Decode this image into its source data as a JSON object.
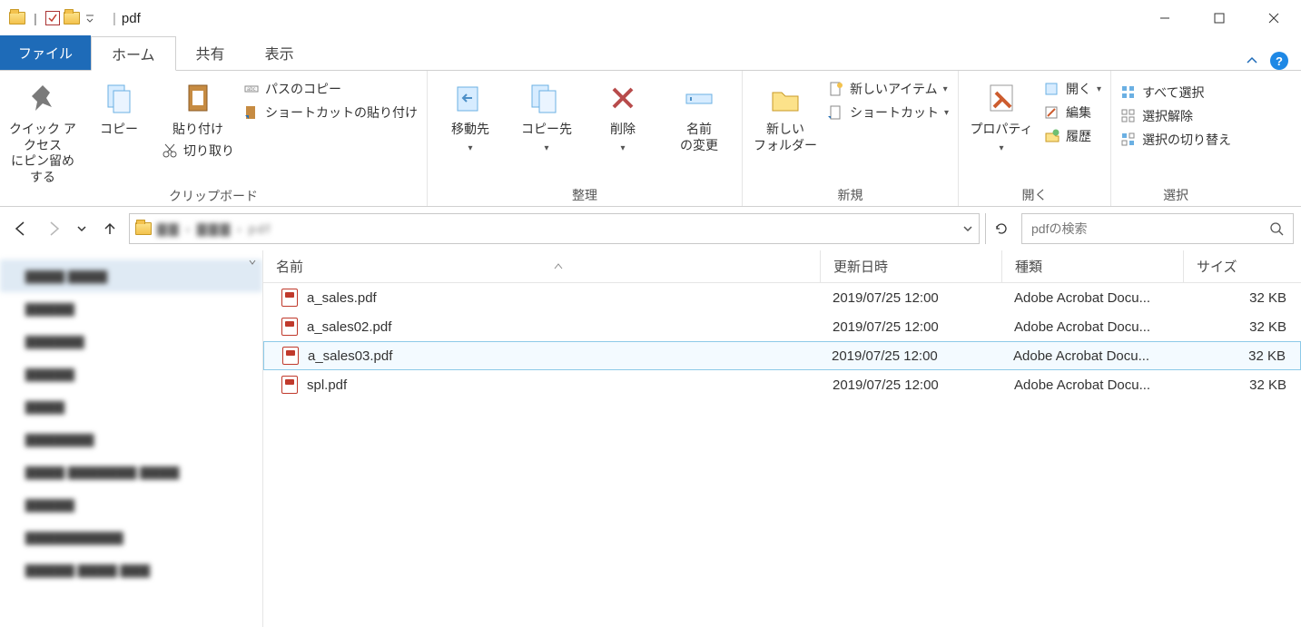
{
  "window": {
    "title": "pdf"
  },
  "tabs": {
    "file": "ファイル",
    "home": "ホーム",
    "share": "共有",
    "view": "表示"
  },
  "ribbon": {
    "clipboard": {
      "pin_label": "クイック アクセス\nにピン留めする",
      "copy_label": "コピー",
      "paste_label": "貼り付け",
      "cut_label": "切り取り",
      "copy_path_label": "パスのコピー",
      "paste_shortcut_label": "ショートカットの貼り付け",
      "group_label": "クリップボード"
    },
    "organize": {
      "move_label": "移動先",
      "copy_to_label": "コピー先",
      "delete_label": "削除",
      "rename_label": "名前\nの変更",
      "group_label": "整理"
    },
    "new": {
      "new_folder_label": "新しい\nフォルダー",
      "new_item_label": "新しいアイテム",
      "shortcut_label": "ショートカット",
      "group_label": "新規"
    },
    "open": {
      "properties_label": "プロパティ",
      "open_label": "開く",
      "edit_label": "編集",
      "history_label": "履歴",
      "group_label": "開く"
    },
    "select": {
      "select_all_label": "すべて選択",
      "select_none_label": "選択解除",
      "invert_label": "選択の切り替え",
      "group_label": "選択"
    }
  },
  "nav": {
    "search_placeholder": "pdfの検索"
  },
  "columns": {
    "name": "名前",
    "date": "更新日時",
    "kind": "種類",
    "size": "サイズ"
  },
  "files": [
    {
      "name": "a_sales.pdf",
      "date": "2019/07/25 12:00",
      "kind": "Adobe Acrobat Docu...",
      "size": "32 KB",
      "selected": false
    },
    {
      "name": "a_sales02.pdf",
      "date": "2019/07/25 12:00",
      "kind": "Adobe Acrobat Docu...",
      "size": "32 KB",
      "selected": false
    },
    {
      "name": "a_sales03.pdf",
      "date": "2019/07/25 12:00",
      "kind": "Adobe Acrobat Docu...",
      "size": "32 KB",
      "selected": true
    },
    {
      "name": "spl.pdf",
      "date": "2019/07/25 12:00",
      "kind": "Adobe Acrobat Docu...",
      "size": "32 KB",
      "selected": false
    }
  ]
}
